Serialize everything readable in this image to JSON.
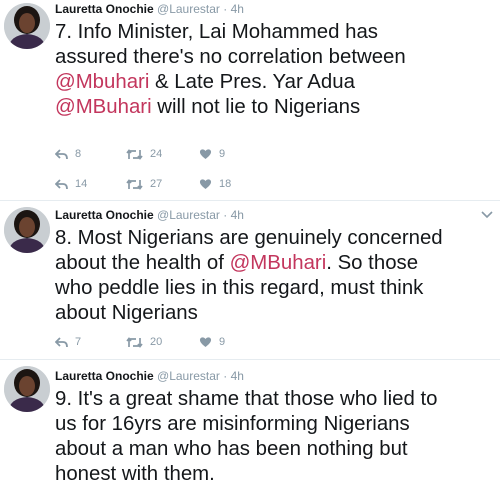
{
  "tweets": [
    {
      "author": "Lauretta Onochie",
      "handle": "@Laurestar",
      "separator": "·",
      "time": "4h",
      "lines": [
        [
          {
            "t": "7. Info Minister, Lai Mohammed has"
          }
        ],
        [
          {
            "t": "assured there's no correlation between"
          }
        ],
        [
          {
            "t": "@Mbuhari",
            "mention": true
          },
          {
            "t": " & Late Pres. Yar Adua"
          }
        ],
        [
          {
            "t": "@MBuhari",
            "mention": true
          },
          {
            "t": " will not lie to Nigerians"
          }
        ]
      ],
      "action_rows": [
        {
          "reply": "8",
          "retweet": "24",
          "like": "9"
        },
        {
          "reply": "14",
          "retweet": "27",
          "like": "18"
        }
      ]
    },
    {
      "author": "Lauretta Onochie",
      "handle": "@Laurestar",
      "separator": "·",
      "time": "4h",
      "lines": [
        [
          {
            "t": "8. Most Nigerians are genuinely concerned"
          }
        ],
        [
          {
            "t": "about the health of "
          },
          {
            "t": "@MBuhari",
            "mention": true
          },
          {
            "t": ". So those"
          }
        ],
        [
          {
            "t": "who peddle lies in this regard, must think"
          }
        ],
        [
          {
            "t": "about Nigerians"
          }
        ]
      ],
      "action_rows": [
        {
          "reply": "7",
          "retweet": "20",
          "like": "9"
        }
      ]
    },
    {
      "author": "Lauretta Onochie",
      "handle": "@Laurestar",
      "separator": "·",
      "time": "4h",
      "lines": [
        [
          {
            "t": "9. It's a great shame that those who lied to"
          }
        ],
        [
          {
            "t": "us for 16yrs are misinforming Nigerians"
          }
        ],
        [
          {
            "t": "about a man who has been nothing but"
          }
        ],
        [
          {
            "t": "honest with them."
          }
        ]
      ],
      "action_rows": []
    }
  ],
  "colors": {
    "mention": "#c3365d",
    "meta": "#8899a6",
    "divider": "#e6ecf0",
    "text": "#14171a"
  },
  "icons": {
    "reply": "reply-icon",
    "retweet": "retweet-icon",
    "like": "heart-icon",
    "more": "chevron-down-icon",
    "avatar": "profile-photo"
  }
}
